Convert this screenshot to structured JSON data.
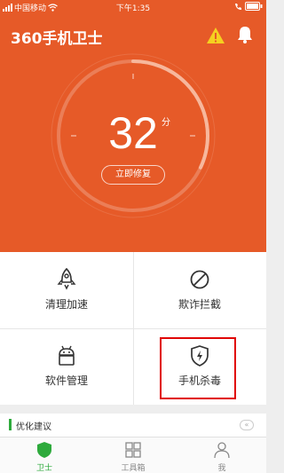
{
  "status_bar": {
    "carrier": "中国移动",
    "time": "下午1:35"
  },
  "header": {
    "app_title": "360手机卫士"
  },
  "score": {
    "value": "32",
    "unit": "分",
    "fix_button_label": "立即修复",
    "progress_fraction": 0.32
  },
  "colors": {
    "brand_orange": "#e65a28",
    "tab_active_green": "#2eaa3c",
    "highlight_red": "#e00000",
    "warning_yellow": "#f5d020"
  },
  "tools": [
    {
      "label": "清理加速",
      "icon": "rocket-icon"
    },
    {
      "label": "欺诈拦截",
      "icon": "block-icon"
    },
    {
      "label": "软件管理",
      "icon": "android-icon"
    },
    {
      "label": "手机杀毒",
      "icon": "shield-bolt-icon"
    }
  ],
  "optimize": {
    "label": "优化建议",
    "collapse_glyph": "«"
  },
  "tabs": [
    {
      "label": "卫士",
      "icon": "shield-icon",
      "active": true
    },
    {
      "label": "工具箱",
      "icon": "grid-icon",
      "active": false
    },
    {
      "label": "我",
      "icon": "person-icon",
      "active": false
    }
  ]
}
